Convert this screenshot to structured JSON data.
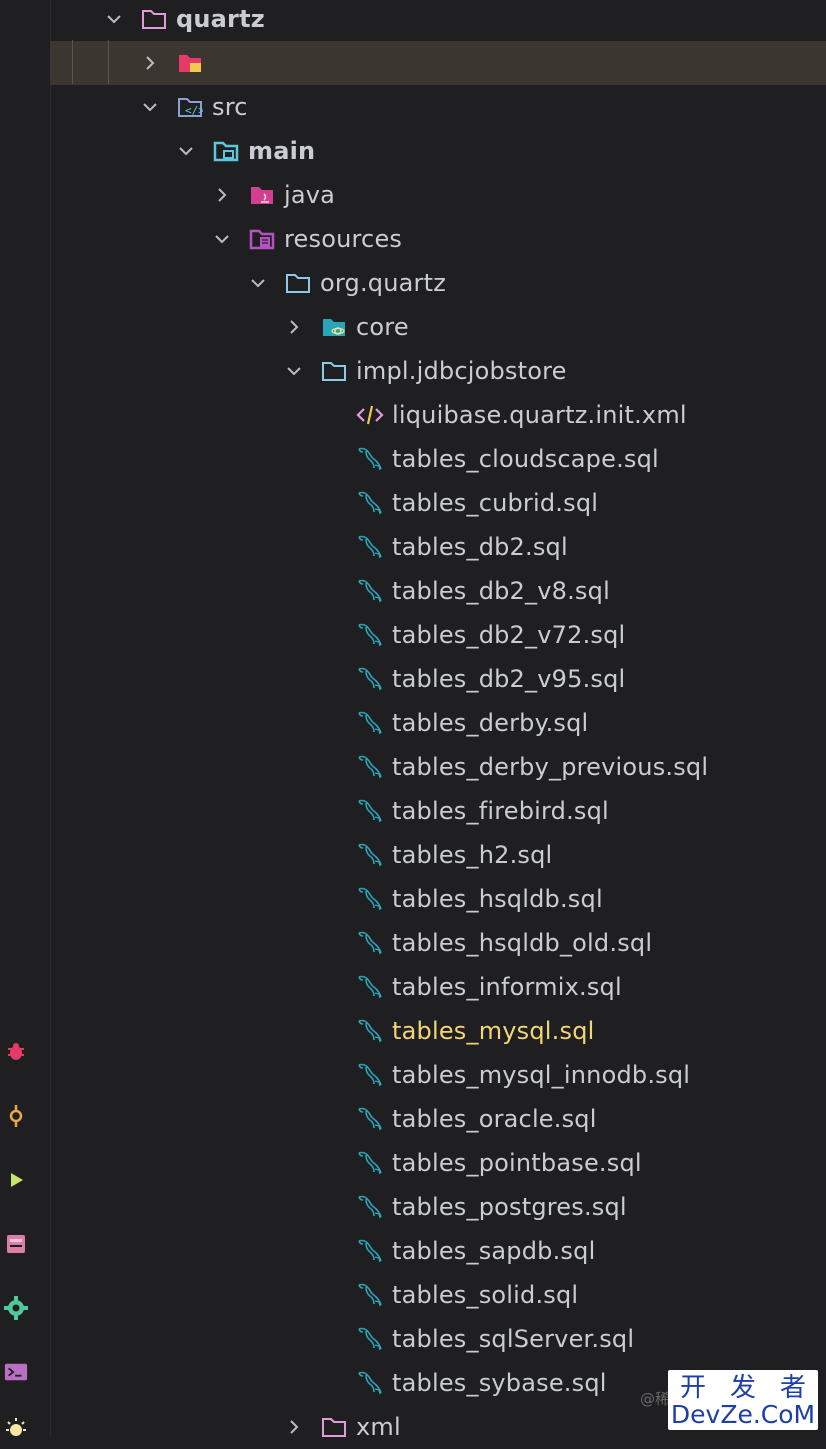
{
  "colors": {
    "background": "#1f1f22",
    "text": "#c9ccd3",
    "highlight_text": "#f2d675",
    "folder_outline": "#e29bd9",
    "source_folder": "#5ec8d8",
    "sql_icon": "#2aa4b8",
    "selected_row": "#3b3730"
  },
  "sidebar_tools": [
    {
      "icon": "bug-icon",
      "color": "#e5396a"
    },
    {
      "icon": "commit-icon",
      "color": "#f0a64a"
    },
    {
      "icon": "run-icon",
      "color": "#c6e36a"
    },
    {
      "icon": "database-icon",
      "color": "#d97fa8"
    },
    {
      "icon": "gear-icon",
      "color": "#4fc99a"
    },
    {
      "icon": "terminal-icon",
      "color": "#b96fc2"
    },
    {
      "icon": "sun-icon",
      "color": "#f5e7a3"
    }
  ],
  "tree": [
    {
      "label": "quartz",
      "bold": true,
      "expanded": true,
      "icon": "folder-icon"
    },
    {
      "label": "",
      "expanded": false,
      "icon": "excluded-folder-icon",
      "selected": true
    },
    {
      "label": "src",
      "expanded": true,
      "icon": "source-folder-icon"
    },
    {
      "label": "main",
      "bold": true,
      "expanded": true,
      "icon": "module-folder-icon"
    },
    {
      "label": "java",
      "expanded": false,
      "icon": "java-folder-icon"
    },
    {
      "label": "resources",
      "expanded": true,
      "icon": "resources-folder-icon"
    },
    {
      "label": "org.quartz",
      "expanded": true,
      "icon": "package-folder-icon"
    },
    {
      "label": "core",
      "expanded": false,
      "icon": "core-package-icon"
    },
    {
      "label": "impl.jdbcjobstore",
      "expanded": true,
      "icon": "package-folder-icon"
    },
    {
      "label": "liquibase.quartz.init.xml",
      "icon": "xml-file-icon"
    },
    {
      "label": "tables_cloudscape.sql",
      "icon": "sql-file-icon"
    },
    {
      "label": "tables_cubrid.sql",
      "icon": "sql-file-icon"
    },
    {
      "label": "tables_db2.sql",
      "icon": "sql-file-icon"
    },
    {
      "label": "tables_db2_v8.sql",
      "icon": "sql-file-icon"
    },
    {
      "label": "tables_db2_v72.sql",
      "icon": "sql-file-icon"
    },
    {
      "label": "tables_db2_v95.sql",
      "icon": "sql-file-icon"
    },
    {
      "label": "tables_derby.sql",
      "icon": "sql-file-icon"
    },
    {
      "label": "tables_derby_previous.sql",
      "icon": "sql-file-icon"
    },
    {
      "label": "tables_firebird.sql",
      "icon": "sql-file-icon"
    },
    {
      "label": "tables_h2.sql",
      "icon": "sql-file-icon"
    },
    {
      "label": "tables_hsqldb.sql",
      "icon": "sql-file-icon"
    },
    {
      "label": "tables_hsqldb_old.sql",
      "icon": "sql-file-icon"
    },
    {
      "label": "tables_informix.sql",
      "icon": "sql-file-icon"
    },
    {
      "label": "tables_mysql.sql",
      "icon": "sql-file-icon",
      "highlight": true
    },
    {
      "label": "tables_mysql_innodb.sql",
      "icon": "sql-file-icon"
    },
    {
      "label": "tables_oracle.sql",
      "icon": "sql-file-icon"
    },
    {
      "label": "tables_pointbase.sql",
      "icon": "sql-file-icon"
    },
    {
      "label": "tables_postgres.sql",
      "icon": "sql-file-icon"
    },
    {
      "label": "tables_sapdb.sql",
      "icon": "sql-file-icon"
    },
    {
      "label": "tables_solid.sql",
      "icon": "sql-file-icon"
    },
    {
      "label": "tables_sqlServer.sql",
      "icon": "sql-file-icon"
    },
    {
      "label": "tables_sybase.sql",
      "icon": "sql-file-icon"
    },
    {
      "label": "xml",
      "expanded": false,
      "icon": "folder-icon"
    }
  ],
  "watermark": {
    "chars": [
      "开",
      "发",
      "者"
    ],
    "brand": "DevZe.CoM",
    "credit": "@稀"
  }
}
